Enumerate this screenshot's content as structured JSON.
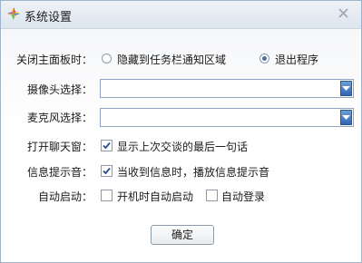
{
  "window": {
    "title": "系统设置",
    "title_icon": "colorful-star-app-icon",
    "close_icon": "close-icon"
  },
  "settings": {
    "close_panel": {
      "label": "关闭主面板时：",
      "options": [
        {
          "label": "隐藏到任务栏通知区域",
          "selected": false
        },
        {
          "label": "退出程序",
          "selected": true
        }
      ]
    },
    "camera": {
      "label": "摄像头选择：",
      "value": ""
    },
    "microphone": {
      "label": "麦克风选择：",
      "value": ""
    },
    "open_chat": {
      "label": "打开聊天窗：",
      "checkbox_label": "显示上次交谈的最后一句话",
      "checked": true
    },
    "notify_sound": {
      "label": "信息提示音：",
      "checkbox_label": "当收到信息时，播放信息提示音",
      "checked": true
    },
    "autostart": {
      "label": "自动启动：",
      "options": [
        {
          "label": "开机时自动启动",
          "checked": false
        },
        {
          "label": "自动登录",
          "checked": false
        }
      ]
    }
  },
  "buttons": {
    "ok": "确定"
  },
  "colors": {
    "accent": "#2f67b0",
    "check": "#2a4f8a"
  }
}
